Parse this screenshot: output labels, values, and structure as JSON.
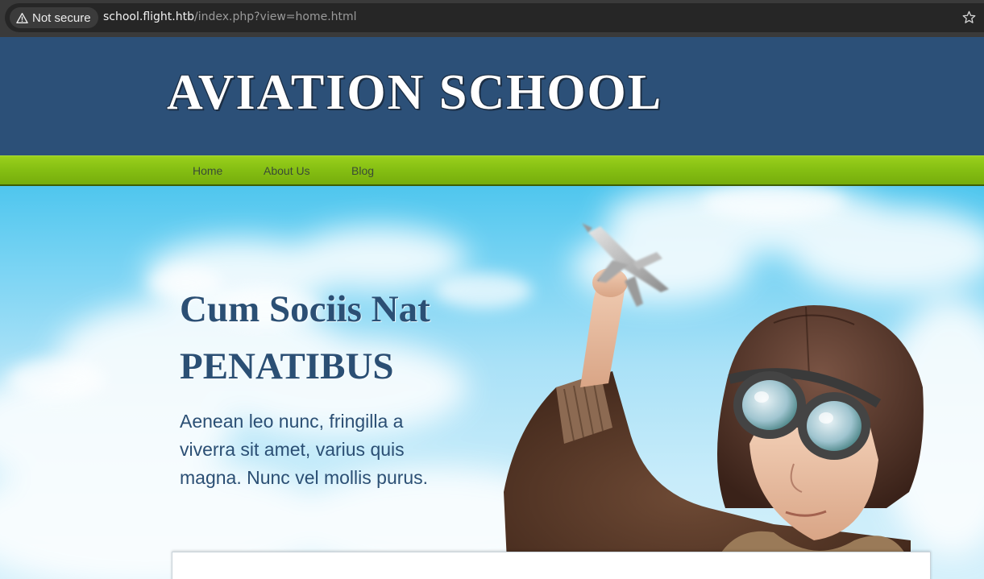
{
  "browser": {
    "security_label": "Not secure",
    "url_host": "school.flight.htb",
    "url_path": "/index.php?view=home.html",
    "icons": {
      "security": "warning-triangle-icon",
      "bookmark": "star-icon"
    }
  },
  "site": {
    "title": "AVIATION SCHOOL",
    "colors": {
      "header": "#2c5078",
      "nav": "#86c013",
      "heading_text": "#2b4f74"
    }
  },
  "nav": {
    "items": [
      {
        "label": "Home"
      },
      {
        "label": "About Us"
      },
      {
        "label": "Blog"
      }
    ]
  },
  "hero": {
    "heading_line1": "Cum Sociis Nat",
    "heading_line2": "PENATIBUS",
    "text": "Aenean leo nunc, fringilla a viverra sit amet, varius quis magna. Nunc vel mollis purus."
  }
}
